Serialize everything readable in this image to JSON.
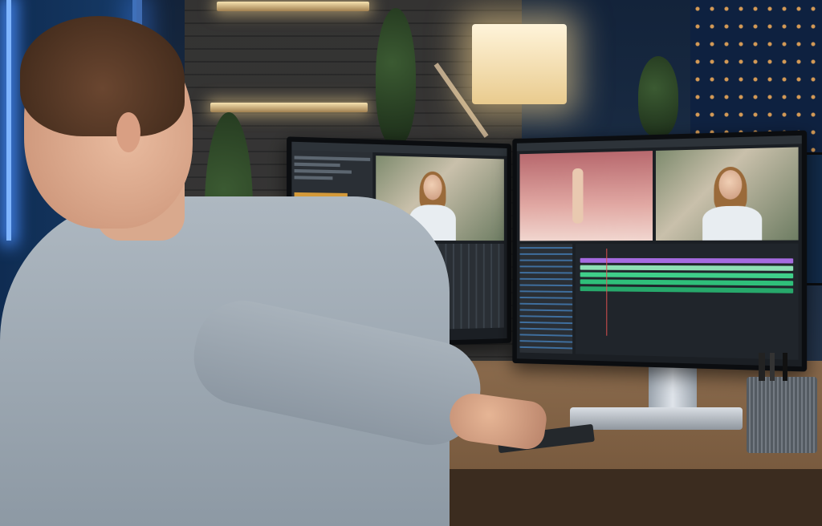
{
  "scene": {
    "description_tag": "video-editing-workstation-photo"
  },
  "colors": {
    "wall_blue": "#13233a",
    "desk_wood": "#8a6a4c",
    "lamp_light": "#fff4da",
    "timeline_purple": "#a56be0",
    "timeline_green": "#2fbf7a",
    "shirt_gray": "#aeb8c1"
  },
  "left_monitor": {
    "icon": "video-editor-screen"
  },
  "right_monitor": {
    "icon": "timeline-editor-screen"
  },
  "icons": [
    "keyboard-icon",
    "tablet-icon",
    "pen-cup-icon",
    "desk-lamp-icon"
  ]
}
